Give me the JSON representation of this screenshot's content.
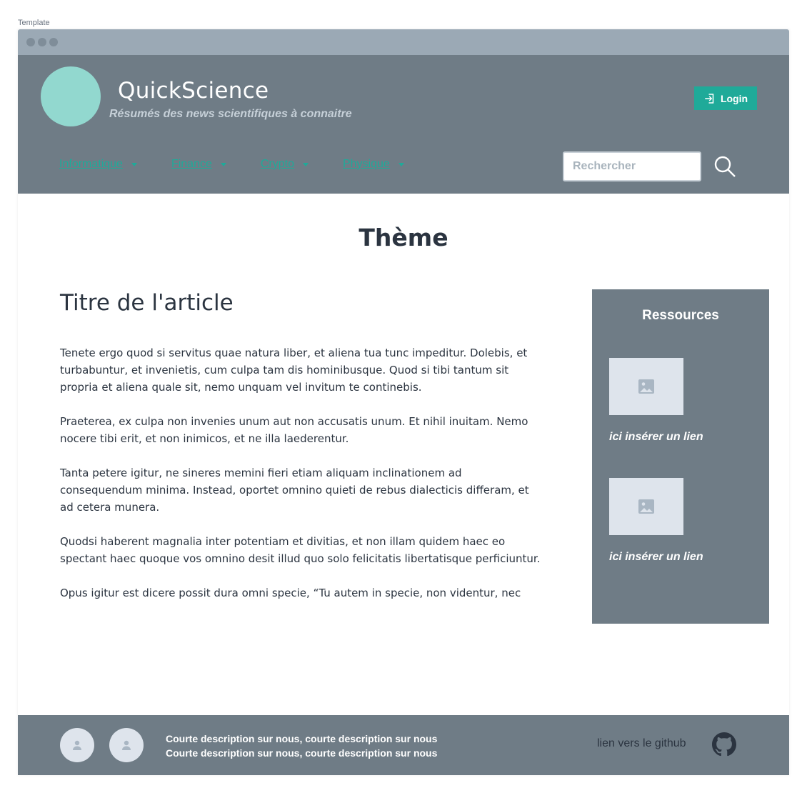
{
  "frame": {
    "label": "Template"
  },
  "header": {
    "site_title": "QuickScience",
    "site_subtitle": "Résumés des news scientifiques à connaitre",
    "login_label": "Login",
    "nav": [
      {
        "label": "Informatique"
      },
      {
        "label": "Finance"
      },
      {
        "label": "Crypto"
      },
      {
        "label": "Physique"
      }
    ],
    "search": {
      "placeholder": "Rechercher",
      "value": ""
    }
  },
  "main": {
    "theme_title": "Thème",
    "article": {
      "title": "Titre de l'article",
      "paragraphs": [
        "Tenete ergo quod si servitus quae natura liber, et aliena tua tunc impeditur. Dolebis, et turbabuntur, et invenietis, cum culpa tam dis hominibusque. Quod si tibi tantum sit propria et aliena quale sit, nemo unquam vel invitum te continebis.",
        "Praeterea, ex culpa non invenies unum aut non accusatis unum. Et nihil inuitam. Nemo nocere tibi erit, et non inimicos, et ne illa laederentur.",
        "Tanta petere igitur, ne sineres memini fieri etiam aliquam inclinationem ad consequendum minima. Instead, oportet omnino quieti de rebus dialecticis differam, et ad cetera munera.",
        "Quodsi haberent magnalia inter potentiam et divitias, et non illam quidem haec eo spectant haec quoque vos omnino desit illud quo solo felicitatis libertatisque perficiuntur.",
        "Opus igitur est dicere possit dura omni specie, “Tu autem in specie, non videntur, nec"
      ]
    },
    "sidebar": {
      "title": "Ressources",
      "resources": [
        {
          "link": "ici insérer un lien"
        },
        {
          "link": "ici insérer un lien"
        }
      ]
    }
  },
  "footer": {
    "description_lines": [
      "Courte description sur nous, courte description sur nous",
      "Courte description sur nous, courte description sur nous"
    ],
    "github_link": "lien vers le github"
  },
  "colors": {
    "header_bg": "#6f7c86",
    "accent": "#1faa99",
    "logo": "#92d8cf",
    "text": "#2b3440",
    "placeholder_image": "#dee4ec"
  },
  "icons": [
    "login-icon",
    "search-icon",
    "image-placeholder-icon",
    "user-icon",
    "github-icon"
  ]
}
